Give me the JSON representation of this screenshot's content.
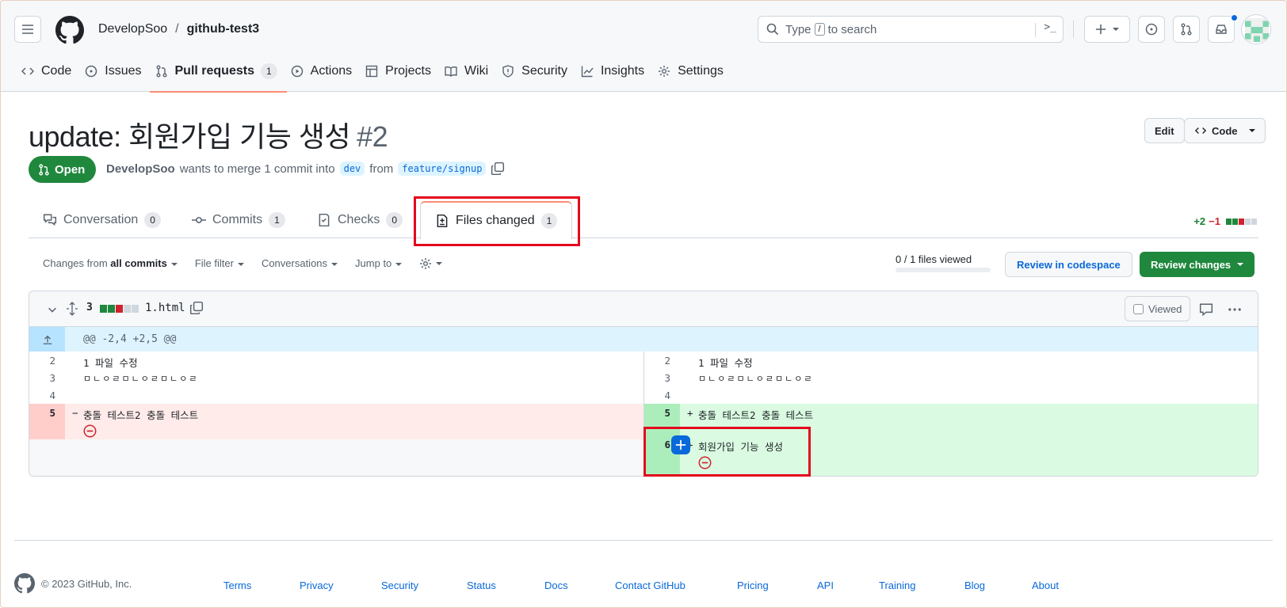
{
  "header": {
    "owner": "DevelopSoo",
    "separator": "/",
    "repo": "github-test3",
    "search_prefix": "Type",
    "search_key": "/",
    "search_suffix": "to search",
    "terminal_glyph": ">_"
  },
  "nav": {
    "items": [
      {
        "label": "Code",
        "icon": "code-icon"
      },
      {
        "label": "Issues",
        "icon": "issue-icon"
      },
      {
        "label": "Pull requests",
        "icon": "pull-request-icon",
        "count": "1",
        "active": true
      },
      {
        "label": "Actions",
        "icon": "play-icon"
      },
      {
        "label": "Projects",
        "icon": "table-icon"
      },
      {
        "label": "Wiki",
        "icon": "book-icon"
      },
      {
        "label": "Security",
        "icon": "shield-icon"
      },
      {
        "label": "Insights",
        "icon": "graph-icon"
      },
      {
        "label": "Settings",
        "icon": "gear-icon"
      }
    ]
  },
  "pr": {
    "title": "update: 회원가입 기능 생성",
    "number": "#2",
    "edit_label": "Edit",
    "code_label": "Code",
    "state": "Open",
    "author": "DevelopSoo",
    "merge_text": "wants to merge 1 commit into",
    "base": "dev",
    "from_text": "from",
    "head": "feature/signup"
  },
  "tabs": [
    {
      "label": "Conversation",
      "count": "0",
      "icon": "comment-discussion-icon"
    },
    {
      "label": "Commits",
      "count": "1",
      "icon": "commit-icon"
    },
    {
      "label": "Checks",
      "count": "0",
      "icon": "checklist-icon"
    },
    {
      "label": "Files changed",
      "count": "1",
      "icon": "file-diff-icon",
      "selected": true
    }
  ],
  "diffstat": {
    "additions": "+2",
    "deletions": "−1"
  },
  "toolbar": {
    "changes_prefix": "Changes from",
    "changes_value": "all commits",
    "file_filter": "File filter",
    "conversations": "Conversations",
    "jump_to": "Jump to",
    "files_viewed": "0 / 1 files viewed",
    "review_codespace": "Review in codespace",
    "review_changes": "Review changes"
  },
  "file": {
    "changes": "3",
    "name": "1.html",
    "viewed_label": "Viewed",
    "hunk_header": "@@ -2,4 +2,5 @@",
    "left": [
      {
        "num": "2",
        "text": "1 파일 수정"
      },
      {
        "num": "3",
        "text": "ㅁㄴㅇㄹㅁㄴㅇㄹㅁㄴㅇㄹ"
      },
      {
        "num": "4",
        "text": ""
      },
      {
        "num": "5",
        "text": "충돌 테스트2 충돌 테스트",
        "marker": "−"
      }
    ],
    "right": [
      {
        "num": "2",
        "text": "1 파일 수정"
      },
      {
        "num": "3",
        "text": "ㅁㄴㅇㄹㅁㄴㅇㄹㅁㄴㅇㄹ"
      },
      {
        "num": "4",
        "text": ""
      },
      {
        "num": "5",
        "text": "충돌 테스트2 충돌 테스트",
        "marker": "+"
      },
      {
        "num": "6",
        "text": "회원가입 기능 생성",
        "marker": "+"
      }
    ]
  },
  "footer": {
    "copyright": "© 2023 GitHub, Inc.",
    "links": [
      "Terms",
      "Privacy",
      "Security",
      "Status",
      "Docs",
      "Contact GitHub",
      "Pricing",
      "API",
      "Training",
      "Blog",
      "About"
    ]
  },
  "colors": {
    "open_green": "#1f883d",
    "accent_blue": "#0969da",
    "deletion_bg": "#ffebe9",
    "addition_bg": "#dafbe1",
    "highlight_red": "#e3091d"
  }
}
